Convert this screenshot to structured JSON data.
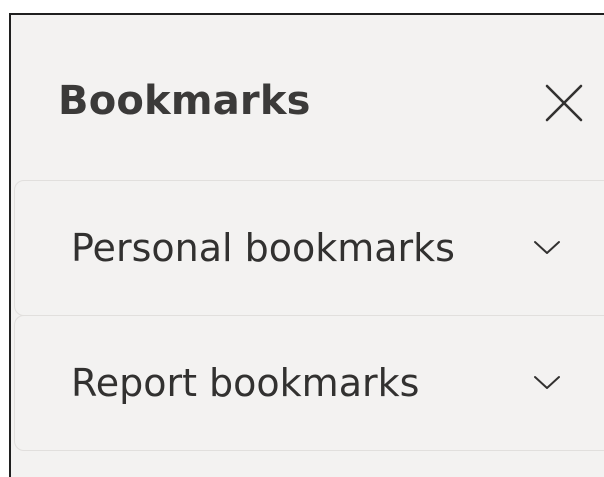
{
  "pane": {
    "title": "Bookmarks",
    "close_icon": "close-icon"
  },
  "sections": [
    {
      "label": "Personal bookmarks",
      "expanded": false,
      "icon": "chevron-down-icon"
    },
    {
      "label": "Report bookmarks",
      "expanded": false,
      "icon": "chevron-down-icon"
    }
  ],
  "colors": {
    "panel_background": "#f3f2f1",
    "text": "#323130",
    "divider": "#e1dfdd"
  }
}
